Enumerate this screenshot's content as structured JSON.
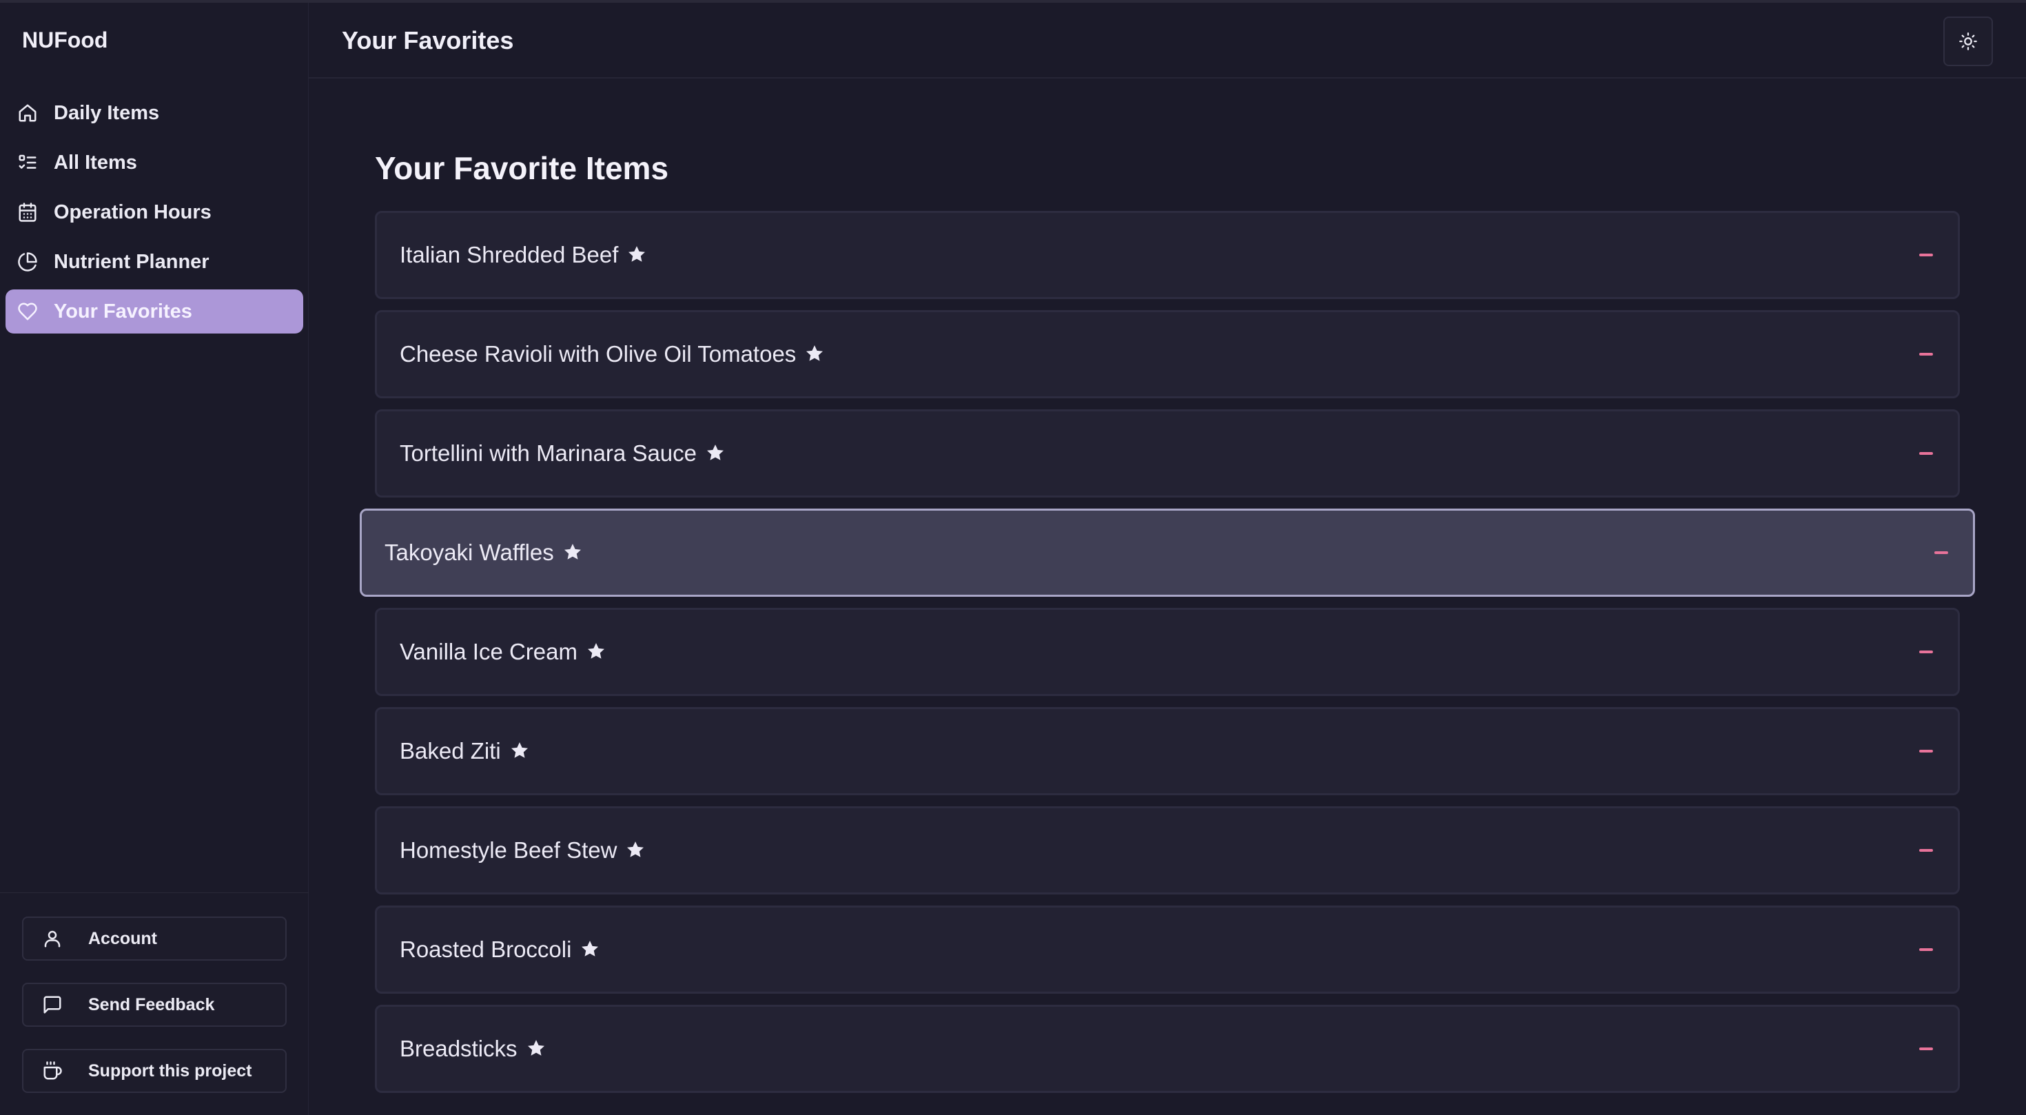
{
  "app": {
    "brand": "NUFood"
  },
  "header": {
    "title": "Your Favorites",
    "theme_icon": "sun-icon"
  },
  "sidebar": {
    "items": [
      {
        "label": "Daily Items",
        "icon": "home-icon"
      },
      {
        "label": "All Items",
        "icon": "list-check-icon"
      },
      {
        "label": "Operation Hours",
        "icon": "calendar-icon"
      },
      {
        "label": "Nutrient Planner",
        "icon": "pie-chart-icon"
      },
      {
        "label": "Your Favorites",
        "icon": "heart-icon",
        "active": true
      }
    ],
    "footer_buttons": [
      {
        "label": "Account",
        "icon": "user-icon"
      },
      {
        "label": "Send Feedback",
        "icon": "message-square-icon"
      },
      {
        "label": "Support this project",
        "icon": "coffee-cup-icon"
      }
    ]
  },
  "main": {
    "title": "Your Favorite Items",
    "favorites": [
      {
        "name": "Italian Shredded Beef"
      },
      {
        "name": "Cheese Ravioli with Olive Oil Tomatoes"
      },
      {
        "name": "Tortellini with Marinara Sauce"
      },
      {
        "name": "Takoyaki Waffles",
        "hovered": true
      },
      {
        "name": "Vanilla Ice Cream"
      },
      {
        "name": "Baked Ziti"
      },
      {
        "name": "Homestyle Beef Stew"
      },
      {
        "name": "Roasted Broccoli"
      },
      {
        "name": "Breadsticks"
      }
    ]
  },
  "colors": {
    "background": "#1b1a29",
    "active_nav": "#ac97d8",
    "card": "#232233",
    "card_hover": "#403f55",
    "remove_accent": "#e8739a"
  }
}
